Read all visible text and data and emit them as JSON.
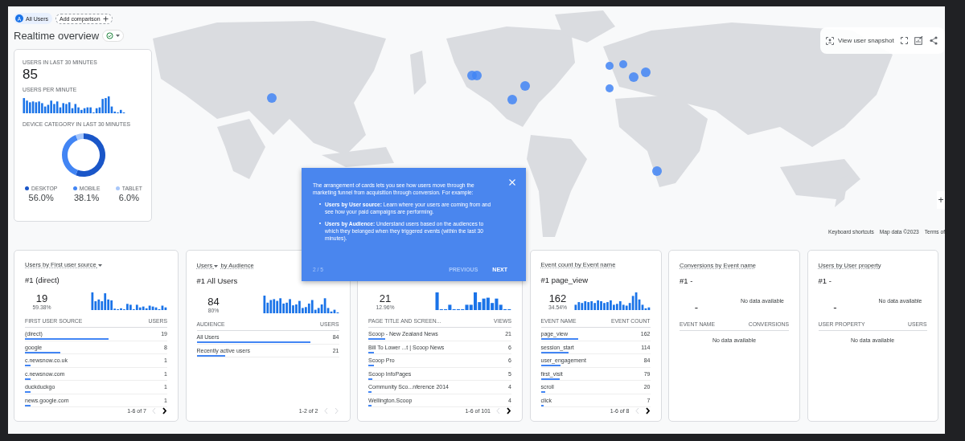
{
  "segment_bar": {
    "segments": [
      {
        "avatar": "A",
        "label": "All Users"
      }
    ],
    "add_comparison": "Add comparison"
  },
  "page_title": "Realtime overview",
  "snapshot_toolbar": {
    "label": "View user snapshot"
  },
  "map": {
    "zoom_in": "+",
    "attribution": [
      "Keyboard shortcuts",
      "Map data ©2023",
      "Terms of"
    ]
  },
  "summary_card": {
    "users_label": "USERS IN LAST 30 MINUTES",
    "users_value": "85",
    "per_minute_label": "USERS PER MINUTE",
    "device_label": "DEVICE CATEGORY IN LAST 30 MINUTES",
    "device_chart": {
      "chart_data": {
        "type": "donut",
        "categories": [
          "DESKTOP",
          "MOBILE",
          "TABLET"
        ],
        "values": [
          56.0,
          38.1,
          6.0
        ]
      }
    },
    "legend": [
      {
        "value": "56.0%",
        "color": "#1a56c8"
      },
      {
        "value": "38.1%",
        "color": "#4285f4"
      },
      {
        "value": "6.0%",
        "color": "#a8c7fa"
      }
    ]
  },
  "report_cards": [
    {
      "title": [
        {
          "text": "Users by First user source",
          "dropdown": true
        }
      ],
      "top": "#1 (direct)",
      "value": "19",
      "share": "59.38%",
      "columns": [
        "FIRST USER SOURCE",
        "USERS"
      ],
      "rows": [
        {
          "label": "(direct)",
          "value": "19",
          "level": 0.59
        },
        {
          "label": "google",
          "value": "8",
          "level": 0.25
        },
        {
          "label": "c.newsnow.co.uk",
          "value": "1",
          "level": 0.04
        },
        {
          "label": "c.newsnow.com",
          "value": "1",
          "level": 0.04
        },
        {
          "label": "duckduckgo",
          "value": "1",
          "level": 0.04
        },
        {
          "label": "news.google.com",
          "value": "1",
          "level": 0.04
        }
      ],
      "pager": {
        "text": "1-6 of 7",
        "prev_disabled": true,
        "next_disabled": false
      }
    },
    {
      "title": [
        {
          "text": "Users",
          "dropdown": true
        },
        {
          "text": "by Audience",
          "dropdown": false
        }
      ],
      "top": "#1 All Users",
      "value": "84",
      "share": "80%",
      "columns": [
        "AUDIENCE",
        "USERS"
      ],
      "rows": [
        {
          "label": "All Users",
          "value": "84",
          "level": 0.8
        },
        {
          "label": "Recently active users",
          "value": "21",
          "level": 0.2
        }
      ],
      "pager": {
        "text": "1-2 of 2",
        "prev_disabled": true,
        "next_disabled": true
      }
    },
    {
      "value": "21",
      "share": "12.96%",
      "columns": [
        "PAGE TITLE AND SCREEN...",
        "VIEWS"
      ],
      "rows": [
        {
          "label": "Scoop - New Zealand News",
          "value": "21",
          "level": 0.12
        },
        {
          "label": "Bill To Lower ...t | Scoop News",
          "value": "6",
          "level": 0.04
        },
        {
          "label": "Scoop Pro",
          "value": "6",
          "level": 0.04
        },
        {
          "label": "Scoop InfoPages",
          "value": "5",
          "level": 0.03
        },
        {
          "label": "Community Sco...nference 2014",
          "value": "4",
          "level": 0.02
        },
        {
          "label": "Wellington.Scoop",
          "value": "4",
          "level": 0.02
        }
      ],
      "pager": {
        "text": "1-6 of 101",
        "prev_disabled": true,
        "next_disabled": false
      }
    },
    {
      "title": [
        {
          "text": "Event count by Event name",
          "dropdown": false
        }
      ],
      "top": "#1 page_view",
      "value": "162",
      "share": "34.54%",
      "columns": [
        "EVENT NAME",
        "EVENT COUNT"
      ],
      "rows": [
        {
          "label": "page_view",
          "value": "162",
          "level": 0.34
        },
        {
          "label": "session_start",
          "value": "114",
          "level": 0.25
        },
        {
          "label": "user_engagement",
          "value": "84",
          "level": 0.18
        },
        {
          "label": "first_visit",
          "value": "79",
          "level": 0.17
        },
        {
          "label": "scroll",
          "value": "20",
          "level": 0.04
        },
        {
          "label": "click",
          "value": "7",
          "level": 0.01
        }
      ],
      "pager": {
        "text": "1-6 of 8",
        "prev_disabled": true,
        "next_disabled": false
      }
    },
    {
      "title": [
        {
          "text": "Conversions by Event name",
          "dropdown": false
        }
      ],
      "top": "#1 -",
      "value": "-",
      "chart_message": "No data available",
      "columns": [
        "EVENT NAME",
        "CONVERSIONS"
      ],
      "table_message": "No data available"
    },
    {
      "title": [
        {
          "text": "Users by User property",
          "dropdown": false
        }
      ],
      "top": "#1 -",
      "value": "-",
      "chart_message": "No data available",
      "columns": [
        "USER PROPERTY",
        "USERS"
      ],
      "table_message": "No data available"
    }
  ],
  "tour_popup": {
    "intro": "The arrangement of cards lets you see how users move through the marketing funnel from acquisition through conversion. For example:",
    "bullets": [
      "**Users by User source:** Learn where your users are coming from and see how your paid campaigns are performing.",
      "**Users by Audience:** Understand users based on the audiences to which they belonged when they triggered events (within the last 30 minutes)."
    ],
    "step": "2 / 5",
    "buttons": [
      {
        "label": "PREVIOUS",
        "disabled": true
      },
      {
        "label": "NEXT",
        "disabled": false
      }
    ]
  }
}
